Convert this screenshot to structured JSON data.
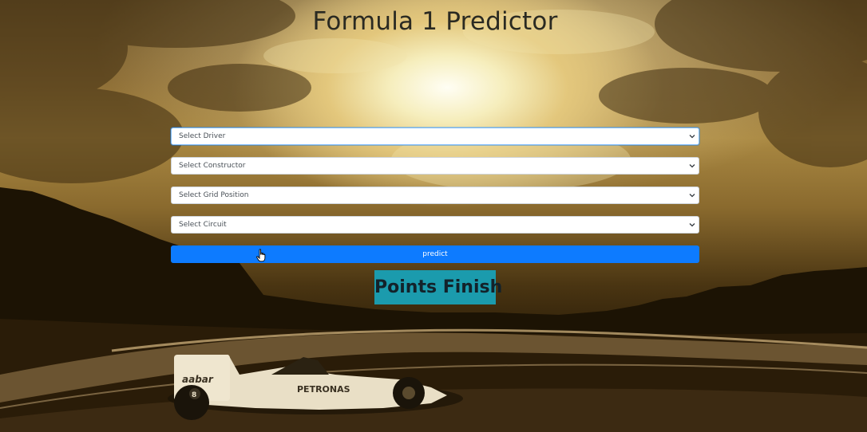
{
  "page": {
    "title": "Formula 1 Predictor"
  },
  "form": {
    "driver_select": "Select Driver",
    "constructor_select": "Select Constructor",
    "grid_select": "Select Grid Position",
    "circuit_select": "Select Circuit",
    "predict_button": "predict"
  },
  "result": {
    "text": "Points Finish"
  },
  "colors": {
    "button": "#0d7bff",
    "result_bg": "#1b9bad"
  },
  "icons": {
    "select_arrow": "chevron-down-icon",
    "cursor": "hand-pointer-icon"
  }
}
